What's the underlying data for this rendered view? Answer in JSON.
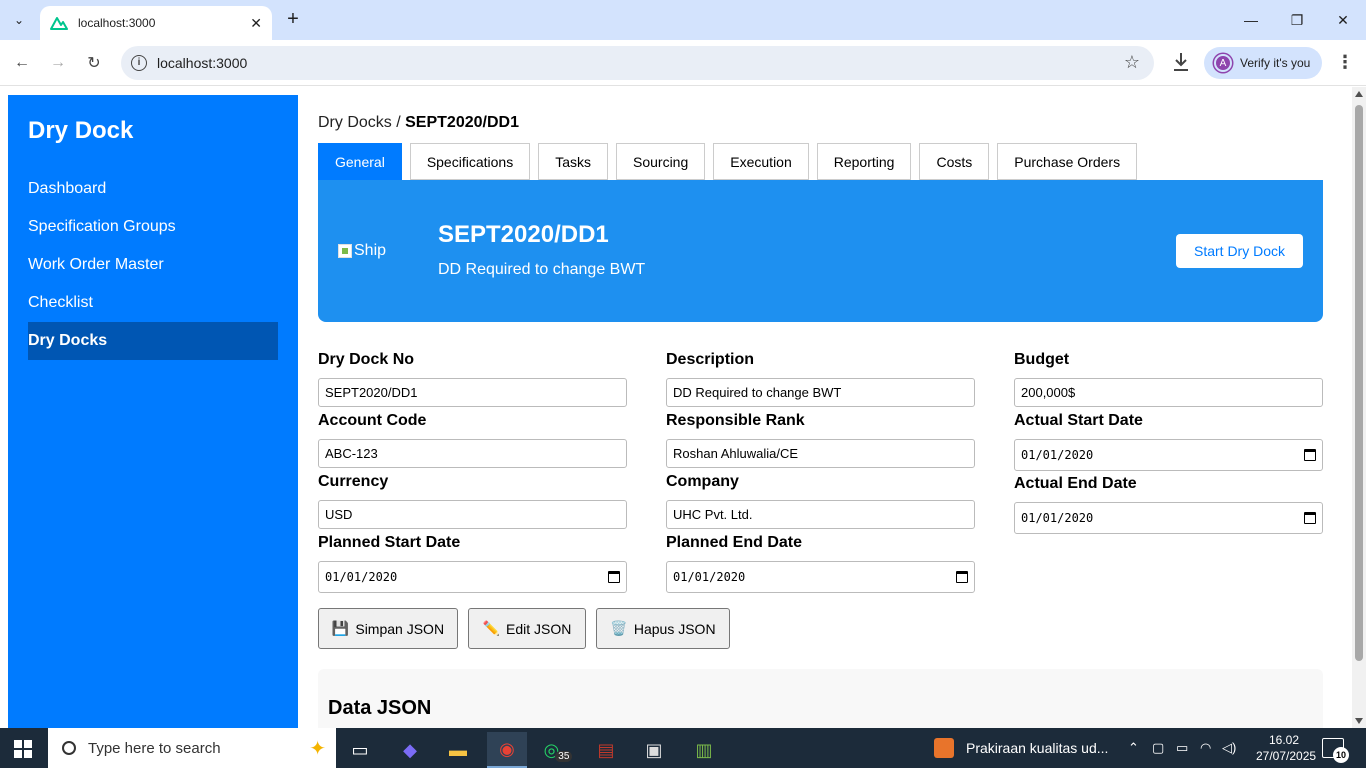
{
  "browser": {
    "tab_title": "localhost:3000",
    "url": "localhost:3000",
    "profile_initial": "A",
    "profile_label": "Verify it's you"
  },
  "sidebar": {
    "brand": "Dry Dock",
    "items": [
      {
        "label": "Dashboard"
      },
      {
        "label": "Specification Groups"
      },
      {
        "label": "Work Order Master"
      },
      {
        "label": "Checklist"
      },
      {
        "label": "Dry Docks",
        "active": true
      }
    ]
  },
  "breadcrumb": {
    "parent": "Dry Docks",
    "separator": " / ",
    "current": "SEPT2020/DD1"
  },
  "tabs": [
    {
      "label": "General",
      "active": true
    },
    {
      "label": "Specifications"
    },
    {
      "label": "Tasks"
    },
    {
      "label": "Sourcing"
    },
    {
      "label": "Execution"
    },
    {
      "label": "Reporting"
    },
    {
      "label": "Costs"
    },
    {
      "label": "Purchase Orders"
    }
  ],
  "hero": {
    "image_alt": "Ship",
    "title": "SEPT2020/DD1",
    "subtitle": "DD Required to change BWT",
    "start_button": "Start Dry Dock"
  },
  "form": {
    "dry_dock_no": {
      "label": "Dry Dock No",
      "value": "SEPT2020/DD1"
    },
    "description": {
      "label": "Description",
      "value": "DD Required to change BWT"
    },
    "budget": {
      "label": "Budget",
      "value": "200,000$"
    },
    "account_code": {
      "label": "Account Code",
      "value": "ABC-123"
    },
    "responsible_rank": {
      "label": "Responsible Rank",
      "value": "Roshan Ahluwalia/CE"
    },
    "actual_start_date": {
      "label": "Actual Start Date",
      "value": "01/01/2020"
    },
    "currency": {
      "label": "Currency",
      "value": "USD"
    },
    "company": {
      "label": "Company",
      "value": "UHC Pvt. Ltd."
    },
    "actual_end_date": {
      "label": "Actual End Date",
      "value": "01/01/2020"
    },
    "planned_start_date": {
      "label": "Planned Start Date",
      "value": "01/01/2020"
    },
    "planned_end_date": {
      "label": "Planned End Date",
      "value": "01/01/2020"
    }
  },
  "actions": {
    "save": {
      "icon": "💾",
      "label": "Simpan JSON"
    },
    "edit": {
      "icon": "✏️",
      "label": "Edit JSON"
    },
    "delete": {
      "icon": "🗑️",
      "label": "Hapus JSON"
    }
  },
  "json_panel": {
    "title": "Data JSON"
  },
  "taskbar": {
    "search_placeholder": "Type here to search",
    "whatsapp_badge": "35",
    "weather_text": "Prakiraan kualitas ud...",
    "time": "16.02",
    "date": "27/07/2025",
    "notifications": "10"
  },
  "colors": {
    "primary": "#007bff",
    "sidebar_active": "#0056b3",
    "hero": "#1e90f0"
  }
}
